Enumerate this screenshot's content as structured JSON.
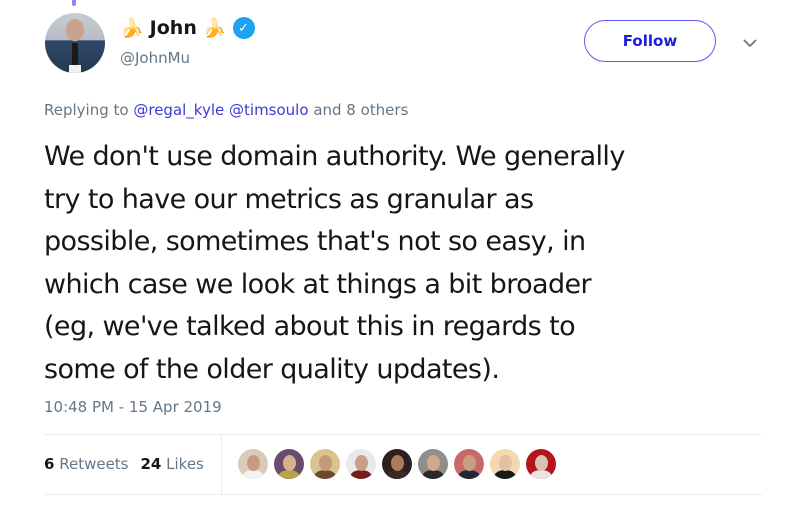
{
  "tweet": {
    "author": {
      "display_name": "John",
      "name_emoji": "🍌",
      "handle": "@JohnMu",
      "verified": true,
      "avatar_icon": "profile-photo"
    },
    "follow_button_label": "Follow",
    "menu_icon": "chevron-down-icon",
    "replying": {
      "prefix": "Replying to",
      "mentions": [
        "@regal_kyle",
        "@timsoulo"
      ],
      "suffix": "and 8 others"
    },
    "text_lines": [
      "We don't use domain authority. We generally",
      "try to have our metrics as granular as",
      "possible, sometimes that's not so easy, in",
      "which case we look at things a bit broader",
      "(eg, we've talked about this in regards to",
      "some of the older quality updates)."
    ],
    "timestamp": "10:48 PM - 15 Apr 2019",
    "stats": {
      "retweets_count": "6",
      "retweets_label": "Retweets",
      "likes_count": "24",
      "likes_label": "Likes"
    },
    "likers": [
      {
        "bg": "#d9cbb8",
        "face": "#c89a82",
        "body": "#f2f2f2"
      },
      {
        "bg": "#6a4a6e",
        "face": "#d7b090",
        "body": "#b8a24a"
      },
      {
        "bg": "#d8c48e",
        "face": "#c49a7a",
        "body": "#6b4a32"
      },
      {
        "bg": "#e9e9e9",
        "face": "#c8a088",
        "body": "#7a1a1a"
      },
      {
        "bg": "#2a2120",
        "face": "#b07a5a",
        "body": "#3a2a25"
      },
      {
        "bg": "#8e8e8e",
        "face": "#d0a88e",
        "body": "#2a2a2a"
      },
      {
        "bg": "#c86a6a",
        "face": "#c7a084",
        "body": "#1e2a3a"
      },
      {
        "bg": "#f3d9b0",
        "face": "#e2c2a2",
        "body": "#1a1a1a"
      },
      {
        "bg": "#b5161c",
        "face": "#d9c2b2",
        "body": "#e6e6e6"
      }
    ],
    "colors": {
      "link": "#3b3bd8",
      "follow_border": "#5b5bf0",
      "follow_text": "#1c1cdb",
      "muted": "#657786",
      "verified": "#1da1f2"
    }
  }
}
